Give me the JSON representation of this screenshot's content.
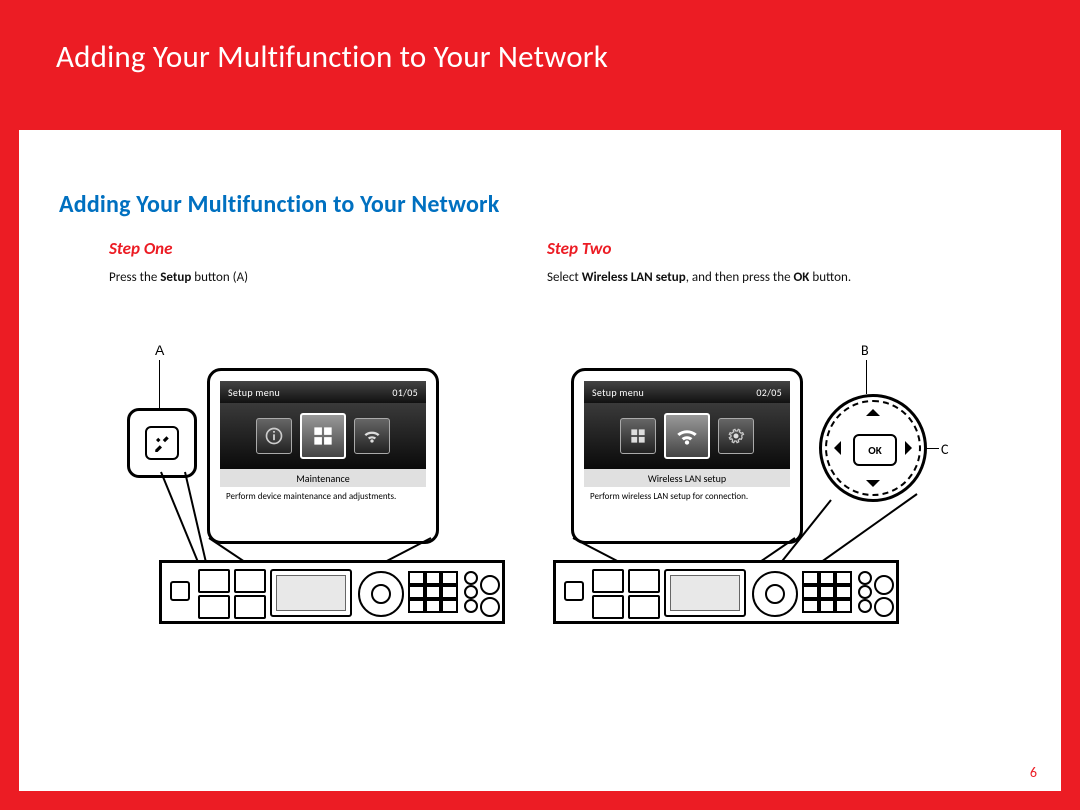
{
  "header": {
    "title": "Adding Your Multifunction to Your Network"
  },
  "subheading": "Adding Your Multifunction to Your Network",
  "page_number": "6",
  "steps": {
    "one": {
      "title": "Step One",
      "body_pre": "Press the ",
      "body_bold": "Setup",
      "body_post": " button (A)"
    },
    "two": {
      "title": "Step Two",
      "body_pre": "Select ",
      "body_bold1": "Wireless LAN setup",
      "body_mid": ", and then press the ",
      "body_bold2": "OK",
      "body_post": " button."
    }
  },
  "callouts": {
    "A": "A",
    "B": "B",
    "C": "C",
    "ok": "OK"
  },
  "lcd1": {
    "menu": "Setup menu",
    "page": "01/05",
    "label": "Maintenance",
    "desc": "Perform device maintenance and adjustments."
  },
  "lcd2": {
    "menu": "Setup menu",
    "page": "02/05",
    "label": "Wireless LAN setup",
    "desc": "Perform wireless LAN setup for connection."
  }
}
